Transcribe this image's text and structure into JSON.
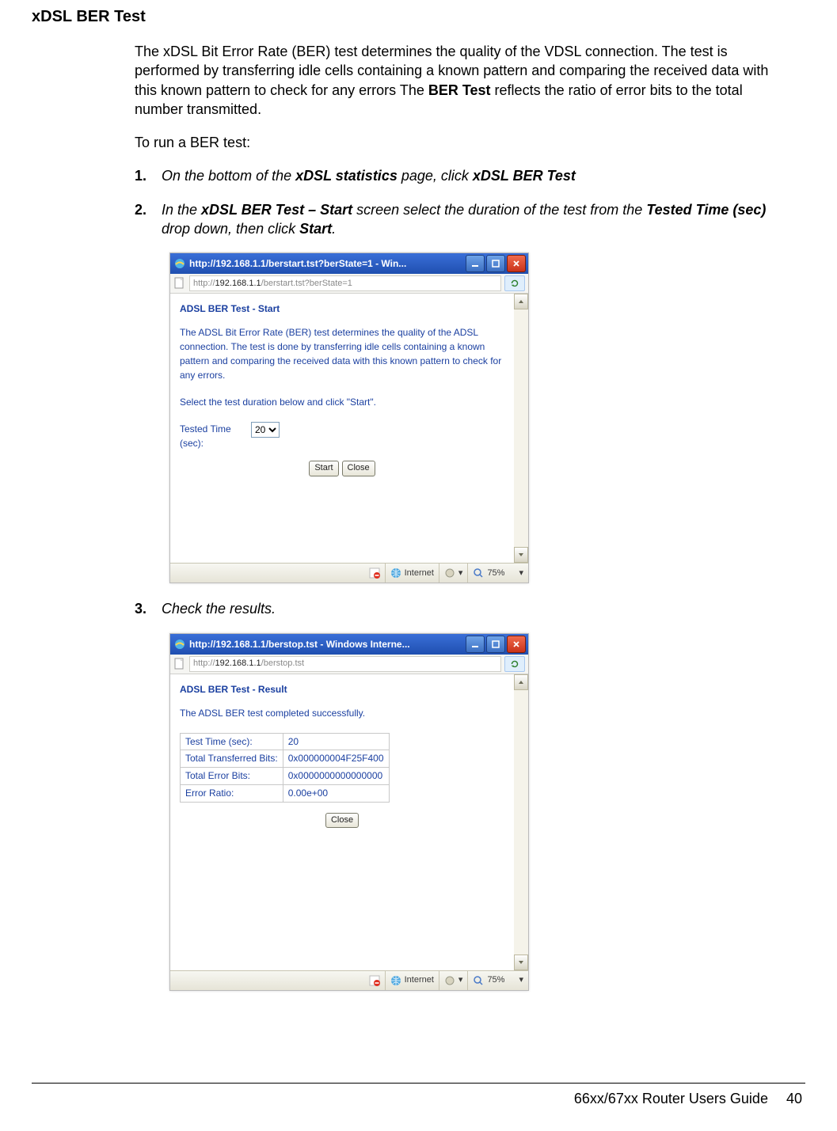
{
  "heading": "xDSL BER Test",
  "para1_text": "The xDSL Bit Error Rate (BER) test determines the quality of the VDSL connection. The test is performed by transferring idle cells containing a known pattern and comparing the received data with this known pattern to check for any errors The ",
  "para1_bold": "BER Test",
  "para1_tail": " reflects the ratio of error bits to the total number transmitted.",
  "para2": "To run a BER test:",
  "steps": [
    {
      "num": "1.",
      "pre": "On the bottom of the ",
      "b1": "xDSL statistics",
      "mid": " page, click ",
      "b2": "xDSL BER Test",
      "post": ""
    },
    {
      "num": "2.",
      "pre": "In the ",
      "b1": "xDSL BER Test – Start",
      "mid": " screen select the duration of the test from the ",
      "b2": "Tested Time (sec)",
      "post": " drop down, then click ",
      "b3": "Start",
      "tail": "."
    },
    {
      "num": "3.",
      "pre": "Check the results.",
      "b1": "",
      "mid": "",
      "b2": "",
      "post": ""
    }
  ],
  "win1": {
    "title": "http://192.168.1.1/berstart.tst?berState=1 - Win...",
    "url_gray_pre": "http://",
    "url_dark": "192.168.1.1",
    "url_gray_post": "/berstart.tst?berState=1",
    "header": "ADSL BER Test - Start",
    "desc": "The ADSL Bit Error Rate (BER) test determines the quality of the ADSL connection. The test is done by transferring idle cells containing a known pattern and comparing the received data with this known pattern to check for any errors.",
    "select_instr": "Select the test duration below and click \"Start\".",
    "tested_label": "Tested Time (sec):",
    "tested_value": "20",
    "btn_start": "Start",
    "btn_close": "Close",
    "status_internet": "Internet",
    "status_zoom": "75%"
  },
  "win2": {
    "title": "http://192.168.1.1/berstop.tst - Windows Interne...",
    "url_gray_pre": "http://",
    "url_dark": "192.168.1.1",
    "url_gray_post": "/berstop.tst",
    "header": "ADSL BER Test - Result",
    "desc": "The ADSL BER test completed successfully.",
    "rows": [
      {
        "k": "Test Time (sec):",
        "v": "20"
      },
      {
        "k": "Total Transferred Bits:",
        "v": "0x000000004F25F400"
      },
      {
        "k": "Total Error Bits:",
        "v": "0x0000000000000000"
      },
      {
        "k": "Error Ratio:",
        "v": "0.00e+00"
      }
    ],
    "btn_close": "Close",
    "status_internet": "Internet",
    "status_zoom": "75%"
  },
  "footer_text": "66xx/67xx Router Users Guide",
  "page_num": "40"
}
